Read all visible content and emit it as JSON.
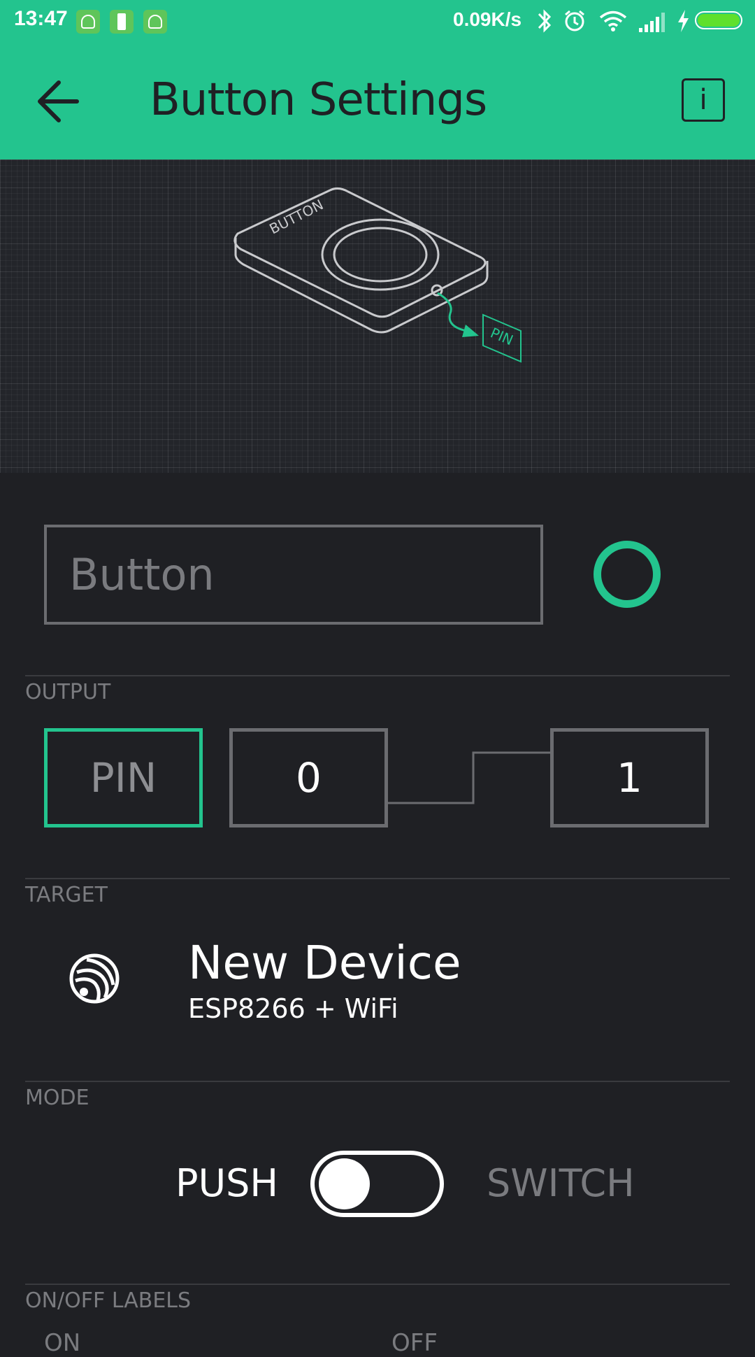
{
  "status_bar": {
    "time": "13:47",
    "net_speed": "0.09K/s",
    "icons": [
      "app-notification-icon",
      "battery-app-icon",
      "app-notification-icon",
      "bluetooth-icon",
      "alarm-icon",
      "wifi-icon",
      "signal-icon",
      "charging-icon",
      "battery-icon"
    ]
  },
  "app_bar": {
    "title": "Button Settings",
    "back_icon": "arrow-left-icon",
    "info_label": "i"
  },
  "illustration": {
    "device_label": "BUTTON",
    "pin_label": "PIN"
  },
  "name_field": {
    "placeholder": "Button",
    "value": ""
  },
  "colors": {
    "accent": "#23c48e",
    "background": "#1f2024",
    "muted": "#7a7b7f"
  },
  "output": {
    "section_label": "OUTPUT",
    "pin_label": "PIN",
    "low_value": "0",
    "high_value": "1"
  },
  "target": {
    "section_label": "TARGET",
    "device_name": "New Device",
    "device_type": "ESP8266 + WiFi",
    "icon": "espressif-icon"
  },
  "mode": {
    "section_label": "MODE",
    "push_label": "PUSH",
    "switch_label": "SWITCH",
    "selected": "PUSH"
  },
  "labels_section": {
    "section_label": "ON/OFF LABELS",
    "on_label": "ON",
    "off_label": "OFF"
  }
}
